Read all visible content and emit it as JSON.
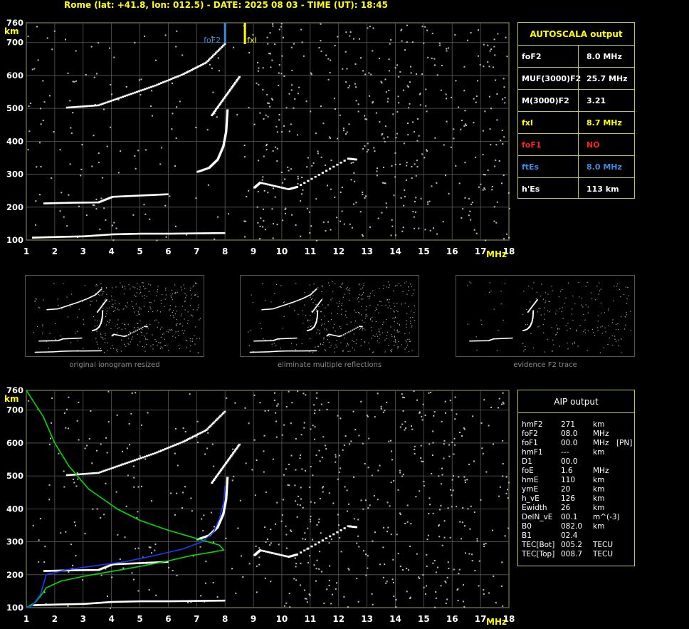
{
  "header": "Rome (lat: +41.8, lon: 012.5) - DATE: 2025 08 03 - TIME (UT): 18:45",
  "chart_data": [
    {
      "type": "scatter",
      "title": "",
      "xlabel": "MHz",
      "ylabel": "km",
      "xlim": [
        1,
        18
      ],
      "ylim": [
        100,
        760
      ],
      "xticks": [
        "1",
        "2",
        "3",
        "4",
        "5",
        "6",
        "7",
        "8",
        "9",
        "10",
        "11",
        "12",
        "13",
        "14",
        "15",
        "16",
        "17",
        "18"
      ],
      "yticks": [
        "100",
        "200",
        "300",
        "400",
        "500",
        "600",
        "700",
        "760"
      ],
      "grid": true,
      "markers": [
        {
          "label": "foF2",
          "x": 8.0,
          "color": "#3a8dde"
        },
        {
          "label": "fxI",
          "x": 8.7,
          "color": "#ffff00"
        }
      ],
      "traces": [
        {
          "name": "E / Es",
          "points": [
            [
              1.2,
              108
            ],
            [
              2,
              110
            ],
            [
              3,
              112
            ],
            [
              4,
              118
            ],
            [
              5,
              120
            ],
            [
              6,
              120
            ],
            [
              7,
              121
            ],
            [
              8,
              122
            ]
          ]
        },
        {
          "name": "F2 o-trace low",
          "points": [
            [
              1.6,
              212
            ],
            [
              2.5,
              214
            ],
            [
              3.5,
              215
            ],
            [
              4,
              232
            ],
            [
              5,
              236
            ],
            [
              6,
              240
            ]
          ]
        },
        {
          "name": "F2 o-trace",
          "points": [
            [
              7.0,
              308
            ],
            [
              7.4,
              320
            ],
            [
              7.7,
              345
            ],
            [
              7.9,
              385
            ],
            [
              8.0,
              430
            ],
            [
              8.05,
              500
            ]
          ]
        },
        {
          "name": "F2 2-hop",
          "points": [
            [
              2.4,
              503
            ],
            [
              3.5,
              510
            ],
            [
              4.5,
              540
            ],
            [
              5.5,
              570
            ],
            [
              6.5,
              605
            ],
            [
              7.3,
              640
            ],
            [
              8.0,
              700
            ]
          ]
        },
        {
          "name": "F2 x-trace",
          "points": [
            [
              7.5,
              480
            ],
            [
              8.0,
              540
            ],
            [
              8.5,
              600
            ]
          ]
        },
        {
          "name": "spread",
          "points": [
            [
              9.0,
              260
            ],
            [
              9.2,
              275
            ],
            [
              10.2,
              255
            ],
            [
              10.5,
              262
            ],
            [
              12.3,
              348
            ],
            [
              12.6,
              345
            ]
          ]
        }
      ]
    },
    {
      "type": "line",
      "title": "",
      "xlabel": "MHz",
      "ylabel": "km",
      "xlim": [
        1,
        18
      ],
      "ylim": [
        100,
        760
      ],
      "xticks": [
        "1",
        "2",
        "3",
        "4",
        "5",
        "6",
        "7",
        "8",
        "9",
        "10",
        "11",
        "12",
        "13",
        "14",
        "15",
        "16",
        "17",
        "18"
      ],
      "yticks": [
        "100",
        "200",
        "300",
        "400",
        "500",
        "600",
        "700",
        "760"
      ],
      "grid": true,
      "series": [
        {
          "name": "",
          "color": "#00dd00",
          "points": [
            [
              1.0,
              100
            ],
            [
              1.3,
              115
            ],
            [
              1.5,
              135
            ],
            [
              1.7,
              160
            ],
            [
              2.2,
              180
            ],
            [
              3,
              195
            ],
            [
              4,
              210
            ],
            [
              5,
              225
            ],
            [
              6,
              242
            ],
            [
              6.8,
              258
            ],
            [
              7.5,
              268
            ],
            [
              7.95,
              275
            ],
            [
              7.8,
              290
            ],
            [
              7,
              310
            ],
            [
              6,
              335
            ],
            [
              5,
              365
            ],
            [
              4.2,
              400
            ],
            [
              3.2,
              460
            ],
            [
              2.5,
              530
            ],
            [
              2.0,
              600
            ],
            [
              1.6,
              680
            ],
            [
              1.0,
              760
            ]
          ]
        },
        {
          "name": "",
          "color": "#1a3cff",
          "points": [
            [
              1.0,
              100
            ],
            [
              1.2,
              105
            ],
            [
              1.5,
              140
            ],
            [
              1.7,
              200
            ],
            [
              2.4,
              215
            ],
            [
              3.5,
              228
            ],
            [
              4.5,
              240
            ],
            [
              5.5,
              258
            ],
            [
              6.5,
              278
            ],
            [
              7.2,
              300
            ],
            [
              7.6,
              330
            ],
            [
              7.8,
              370
            ],
            [
              7.95,
              420
            ],
            [
              8.0,
              470
            ]
          ]
        }
      ]
    }
  ],
  "autoscala": {
    "title": "AUTOSCALA output",
    "rows": [
      {
        "label": "foF2",
        "value": "8.0 MHz",
        "color": "#ffffff"
      },
      {
        "label": "MUF(3000)F2",
        "value": "25.7 MHz",
        "color": "#ffffff"
      },
      {
        "label": "M(3000)F2",
        "value": "3.21",
        "color": "#ffffff"
      },
      {
        "label": "fxI",
        "value": "8.7 MHz",
        "color": "#ffff00"
      },
      {
        "label": "foF1",
        "value": "NO",
        "color": "#ff2020"
      },
      {
        "label": "ftEs",
        "value": "8.0 MHz",
        "color": "#3a8dde"
      },
      {
        "label": "h'Es",
        "value": "113    km",
        "color": "#ffffff"
      }
    ]
  },
  "thumbnails": [
    {
      "caption": "original ionogram resized"
    },
    {
      "caption": "eliminate multiple reflections"
    },
    {
      "caption": "evidence F2 trace"
    }
  ],
  "aip": {
    "title": "AIP output",
    "rows": [
      {
        "name": "hmF2",
        "value": "271",
        "unit": "km",
        "extra": ""
      },
      {
        "name": "foF2",
        "value": "08.0",
        "unit": "MHz",
        "extra": ""
      },
      {
        "name": "foF1",
        "value": "00.0",
        "unit": "MHz",
        "extra": "[PN]"
      },
      {
        "name": "hmF1",
        "value": "---",
        "unit": "km",
        "extra": ""
      },
      {
        "name": "D1",
        "value": "00.0",
        "unit": "",
        "extra": ""
      },
      {
        "name": "foE",
        "value": "1.6",
        "unit": "MHz",
        "extra": ""
      },
      {
        "name": "hmE",
        "value": "110",
        "unit": "km",
        "extra": ""
      },
      {
        "name": "ymE",
        "value": "20",
        "unit": "km",
        "extra": ""
      },
      {
        "name": "h_vE",
        "value": "126",
        "unit": "km",
        "extra": ""
      },
      {
        "name": "Ewidth",
        "value": "26",
        "unit": "km",
        "extra": ""
      },
      {
        "name": "DelN_vE",
        "value": "00.1",
        "unit": "m^(-3)",
        "extra": ""
      },
      {
        "name": "B0",
        "value": "082.0",
        "unit": "km",
        "extra": ""
      },
      {
        "name": "B1",
        "value": "02.4",
        "unit": "",
        "extra": ""
      },
      {
        "name": "TEC[Bot]",
        "value": "005.2",
        "unit": "TECU",
        "extra": ""
      },
      {
        "name": "TEC[Top]",
        "value": "008.7",
        "unit": "TECU",
        "extra": ""
      }
    ]
  }
}
